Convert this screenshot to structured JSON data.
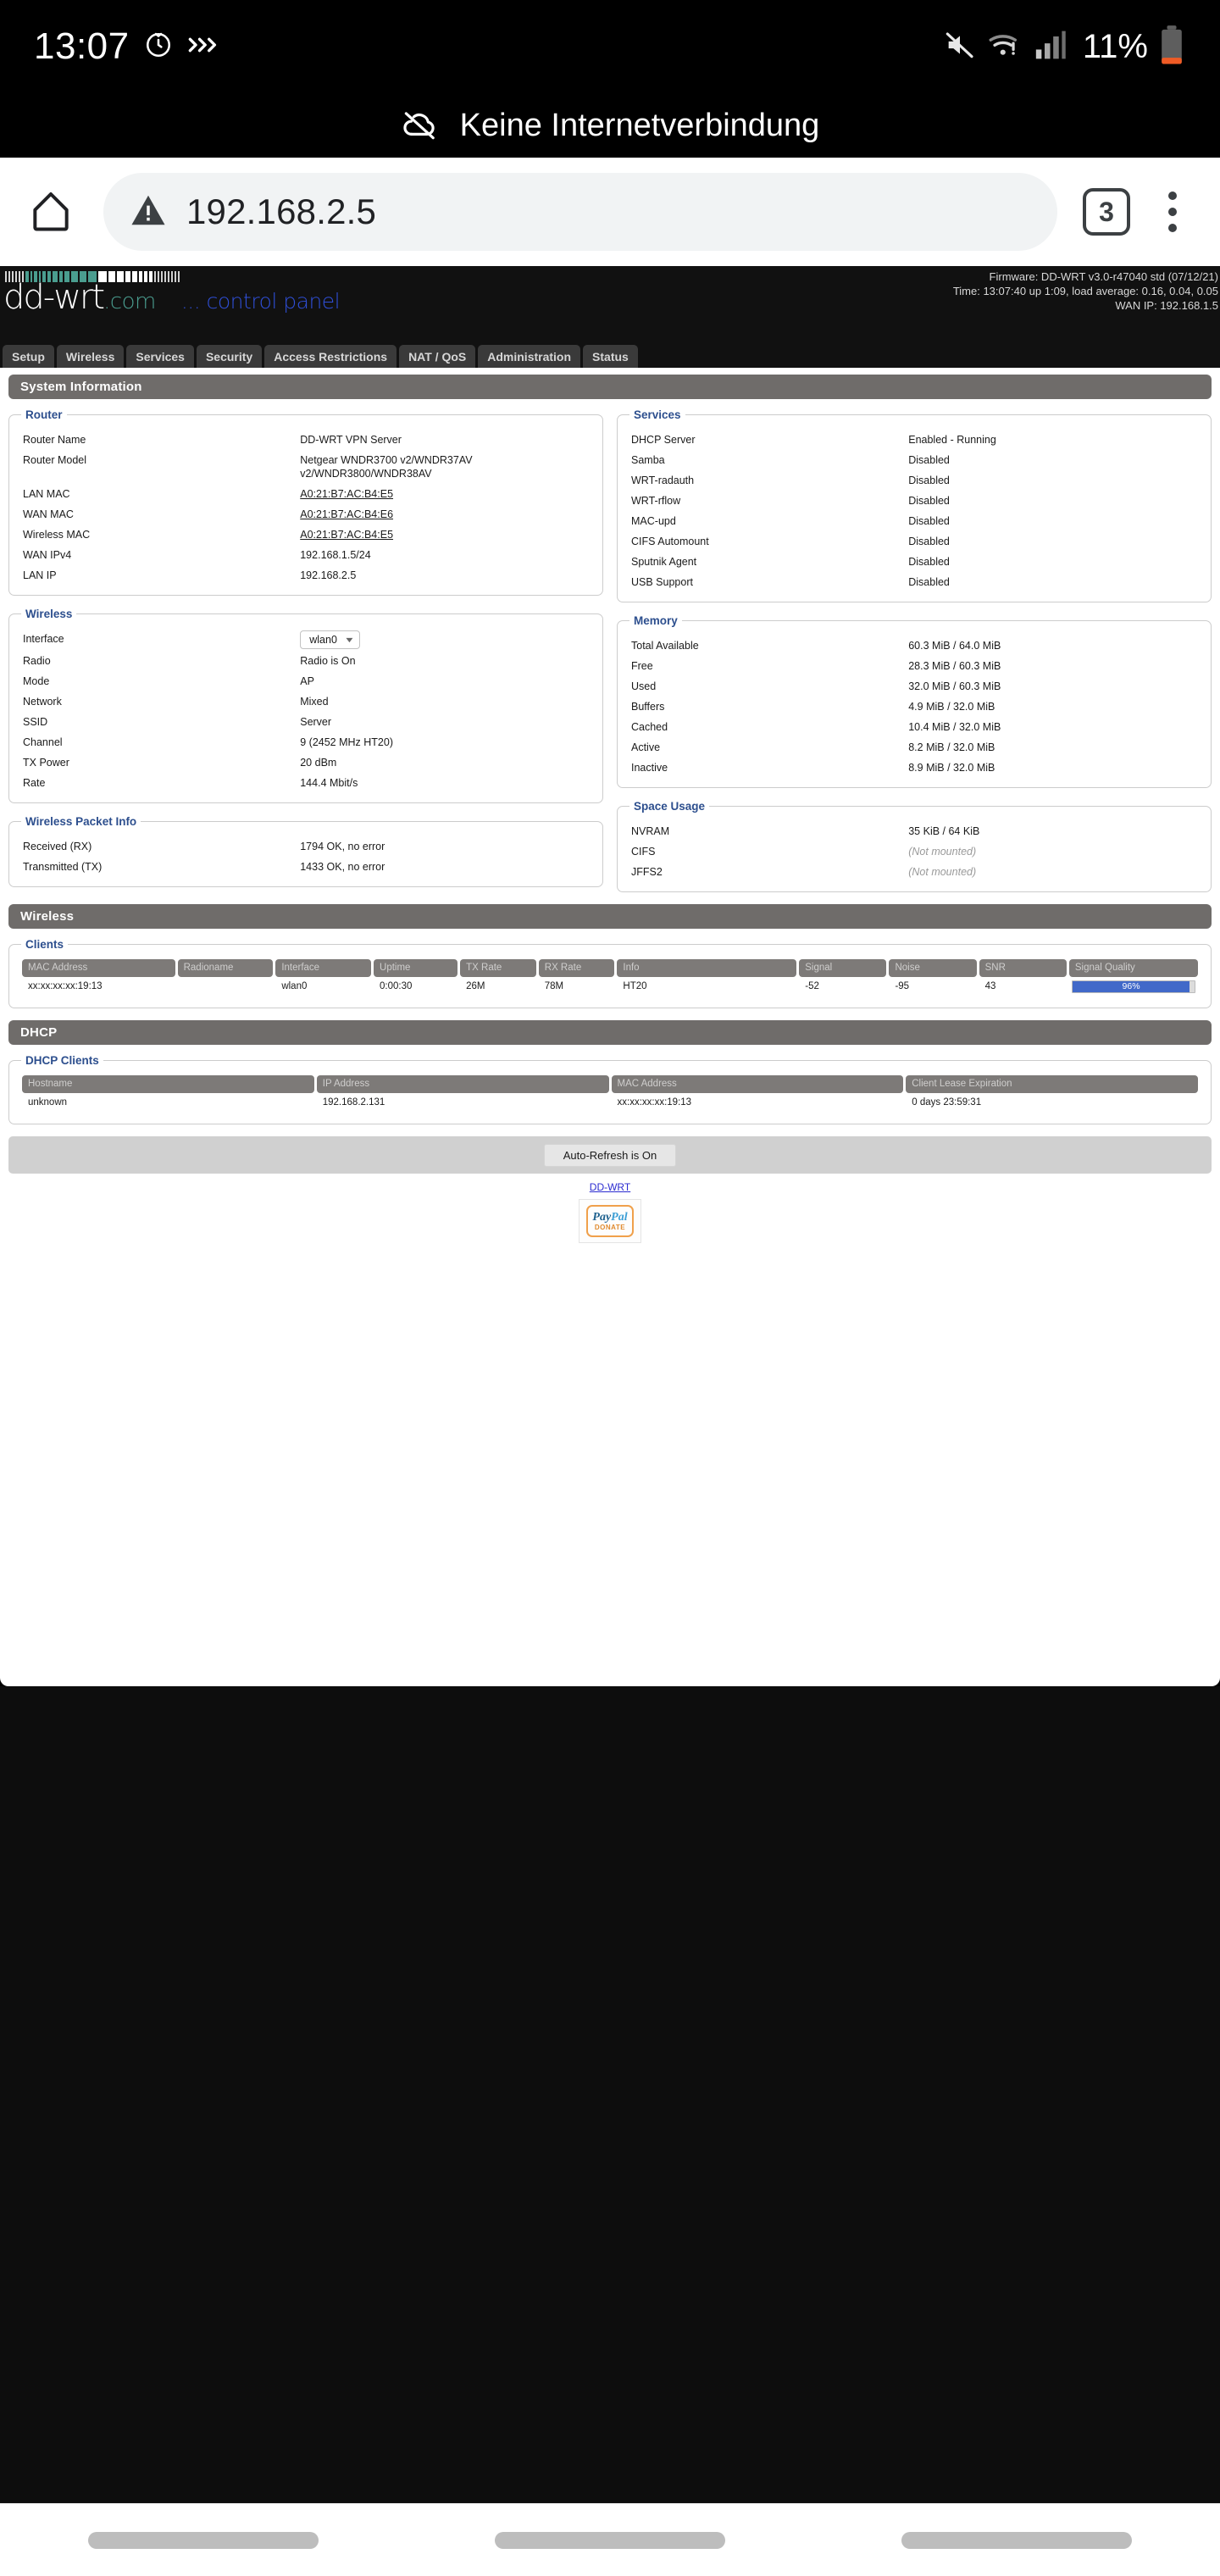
{
  "status_bar": {
    "clock": "13:07",
    "battery_percent": "11%",
    "icons": [
      "alarm-icon",
      "chevron-double-right-icon",
      "mute-icon",
      "wifi-warning-icon",
      "cellular-signal-icon",
      "battery-icon"
    ]
  },
  "notification": {
    "text": "Keine Internetverbindung",
    "icon": "cloud-off-icon"
  },
  "browser": {
    "home_icon": "home-icon",
    "security_icon": "warning-triangle-icon",
    "url": "192.168.2.5",
    "tab_count": "3",
    "menu_icon": "kebab-menu-icon"
  },
  "ddwrt": {
    "logo_dd": "dd-wrt",
    "logo_com": ".com",
    "logo_control_panel": "... control panel",
    "firmware": "Firmware: DD-WRT v3.0-r47040 std (07/12/21)",
    "time": "Time: 13:07:40 up 1:09, load average: 0.16, 0.04, 0.05",
    "wan_ip": "WAN IP: 192.168.1.5",
    "tabs": [
      "Setup",
      "Wireless",
      "Services",
      "Security",
      "Access Restrictions",
      "NAT / QoS",
      "Administration",
      "Status"
    ],
    "active_tab": "Status"
  },
  "system_information": {
    "title": "System Information",
    "router": {
      "legend": "Router",
      "rows": [
        {
          "label": "Router Name",
          "value": "DD-WRT VPN Server",
          "link": false
        },
        {
          "label": "Router Model",
          "value": "Netgear WNDR3700 v2/WNDR37AV v2/WNDR3800/WNDR38AV",
          "link": false
        },
        {
          "label": "LAN MAC",
          "value": "A0:21:B7:AC:B4:E5",
          "link": true
        },
        {
          "label": "WAN MAC",
          "value": "A0:21:B7:AC:B4:E6",
          "link": true
        },
        {
          "label": "Wireless MAC",
          "value": "A0:21:B7:AC:B4:E5",
          "link": true
        },
        {
          "label": "WAN IPv4",
          "value": "192.168.1.5/24",
          "link": false
        },
        {
          "label": "LAN IP",
          "value": "192.168.2.5",
          "link": false
        }
      ]
    },
    "services": {
      "legend": "Services",
      "rows": [
        {
          "label": "DHCP Server",
          "value": "Enabled - Running"
        },
        {
          "label": "Samba",
          "value": "Disabled"
        },
        {
          "label": "WRT-radauth",
          "value": "Disabled"
        },
        {
          "label": "WRT-rflow",
          "value": "Disabled"
        },
        {
          "label": "MAC-upd",
          "value": "Disabled"
        },
        {
          "label": "CIFS Automount",
          "value": "Disabled"
        },
        {
          "label": "Sputnik Agent",
          "value": "Disabled"
        },
        {
          "label": "USB Support",
          "value": "Disabled"
        }
      ]
    },
    "wireless": {
      "legend": "Wireless",
      "interface_label": "Interface",
      "interface_value": "wlan0",
      "rows": [
        {
          "label": "Radio",
          "value": "Radio is On"
        },
        {
          "label": "Mode",
          "value": "AP"
        },
        {
          "label": "Network",
          "value": "Mixed"
        },
        {
          "label": "SSID",
          "value": "Server"
        },
        {
          "label": "Channel",
          "value": "9 (2452 MHz HT20)"
        },
        {
          "label": "TX Power",
          "value": "20 dBm"
        },
        {
          "label": "Rate",
          "value": "144.4 Mbit/s"
        }
      ]
    },
    "memory": {
      "legend": "Memory",
      "rows": [
        {
          "label": "Total Available",
          "value": "60.3 MiB / 64.0 MiB"
        },
        {
          "label": "Free",
          "value": "28.3 MiB / 60.3 MiB"
        },
        {
          "label": "Used",
          "value": "32.0 MiB / 60.3 MiB"
        },
        {
          "label": "Buffers",
          "value": "4.9 MiB / 32.0 MiB"
        },
        {
          "label": "Cached",
          "value": "10.4 MiB / 32.0 MiB"
        },
        {
          "label": "Active",
          "value": "8.2 MiB / 32.0 MiB"
        },
        {
          "label": "Inactive",
          "value": "8.9 MiB / 32.0 MiB"
        }
      ]
    },
    "wireless_packet_info": {
      "legend": "Wireless Packet Info",
      "rows": [
        {
          "label": "Received (RX)",
          "value": "1794 OK, no error"
        },
        {
          "label": "Transmitted (TX)",
          "value": "1433 OK, no error"
        }
      ]
    },
    "space_usage": {
      "legend": "Space Usage",
      "rows": [
        {
          "label": "NVRAM",
          "value": "35 KiB / 64 KiB",
          "muted": false
        },
        {
          "label": "CIFS",
          "value": "(Not mounted)",
          "muted": true
        },
        {
          "label": "JFFS2",
          "value": "(Not mounted)",
          "muted": true
        }
      ]
    }
  },
  "wireless_section": {
    "title": "Wireless",
    "clients": {
      "legend": "Clients",
      "columns": [
        "MAC Address",
        "Radioname",
        "Interface",
        "Uptime",
        "TX Rate",
        "RX Rate",
        "Info",
        "Signal",
        "Noise",
        "SNR",
        "Signal Quality"
      ],
      "rows": [
        {
          "mac": "xx:xx:xx:xx:19:13",
          "radioname": "",
          "interface": "wlan0",
          "uptime": "0:00:30",
          "tx_rate": "26M",
          "rx_rate": "78M",
          "info": "HT20",
          "signal": "-52",
          "noise": "-95",
          "snr": "43",
          "signal_quality": "96%",
          "signal_quality_pct": 96
        }
      ]
    }
  },
  "dhcp_section": {
    "title": "DHCP",
    "clients": {
      "legend": "DHCP Clients",
      "columns": [
        "Hostname",
        "IP Address",
        "MAC Address",
        "Client Lease Expiration"
      ],
      "rows": [
        {
          "hostname": "unknown",
          "ip": "192.168.2.131",
          "mac": "xx:xx:xx:xx:19:13",
          "lease": "0 days 23:59:31"
        }
      ]
    }
  },
  "footer": {
    "auto_refresh": "Auto-Refresh is On",
    "ddwrt_link": "DD-WRT",
    "paypal_pay": "Pay",
    "paypal_pal": "Pal",
    "paypal_donate": "DONATE"
  },
  "colors": {
    "accent_blue": "#2d4f8e",
    "section_gray": "#6f6c6a",
    "signal_bar": "#4169c9",
    "logo_teal": "#4a9d8f",
    "logo_blue": "#2f4fd8",
    "battery_low": "#ef5b25"
  }
}
